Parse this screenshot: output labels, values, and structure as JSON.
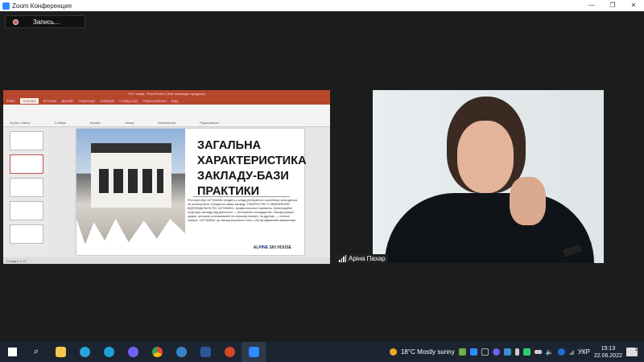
{
  "window": {
    "title": "Zoom Конференция",
    "minimize": "—",
    "maximize": "❐",
    "close": "✕"
  },
  "record_button": {
    "label": "Запись..."
  },
  "shared_screen": {
    "app_title": "ППТ пакер - PowerPoint (Сбой активации продукта)",
    "ribbon_tabs": [
      "Файл",
      "Основні",
      "Вставка",
      "Дизайн",
      "Переходи",
      "Анімація",
      "Слайд-шоу",
      "Рецензування",
      "Вид"
    ],
    "ribbon_groups": [
      "Буфер обміну",
      "Слайди",
      "Шрифт",
      "Абзац",
      "Малювання",
      "Редагування"
    ],
    "slide": {
      "title": "ЗАГАЛЬНА ХАРАКТЕРИСТИКА ЗАКЛАДУ-БАЗИ ПРАКТИКИ",
      "body": "Ресторан-бар «ATTAMAN» входить у склад ресторанного комплексу, знаходиться на околиці міста. Юридична назва закладу: ТОВАРИСТВО З ОБМЕЖЕНОЮ ВІДПОВІДАЛЬНІСТЮ «ATTAMAN», форма власності приватна. Організаційна структура закладу, вид діяльності — ресторанне господарство. Заклад працює щодня, ресторан розташований на першому поверсі, на другому — готельні номери. «ATTAMAN» це заклад загального типу з обслуговуванням офіціантами.",
      "brand_1": "ALPINE",
      "brand_2": "SKI HOUSE"
    },
    "status": "Слайд 2 із 15"
  },
  "participant": {
    "name": "Аріна Пахар"
  },
  "taskbar": {
    "weather": "18°C  Mostly sunny",
    "language": "УКР",
    "time": "15:13",
    "date": "22.06.2022",
    "notifications": "1"
  }
}
